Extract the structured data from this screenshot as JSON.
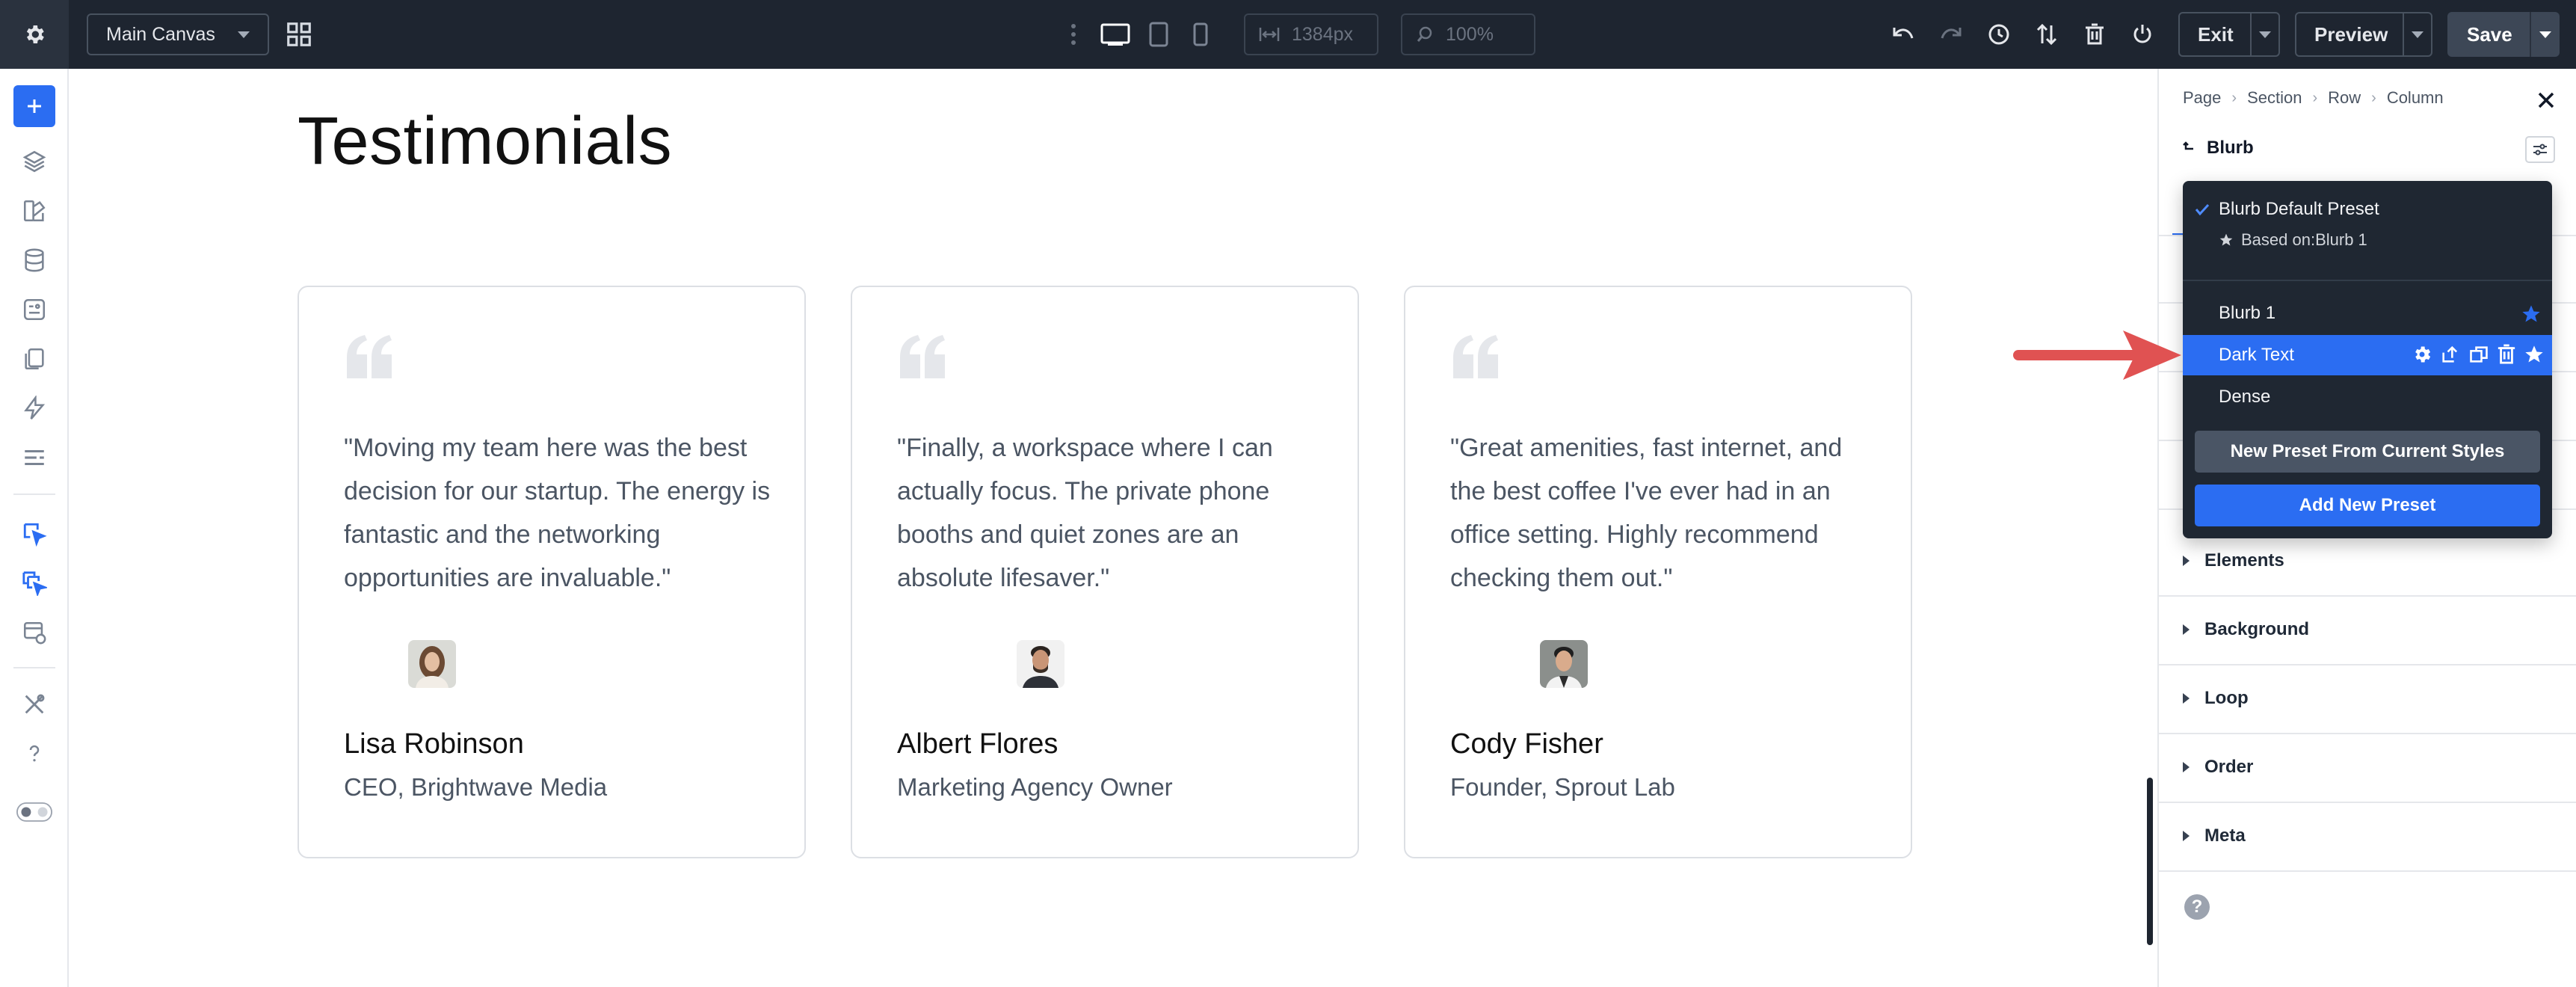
{
  "toolbar": {
    "canvas_select": "Main Canvas",
    "width_value": "1384px",
    "zoom_value": "100%",
    "exit_label": "Exit",
    "preview_label": "Preview",
    "save_label": "Save"
  },
  "canvas": {
    "title": "Testimonials",
    "cards": [
      {
        "quote": "\"Moving my team here was the best decision for our startup. The energy is fantastic and the networking opportunities are invaluable.\"",
        "name": "Lisa Robinson",
        "role": "CEO, Brightwave Media"
      },
      {
        "quote": "\"Finally, a workspace where I can actually focus. The private phone booths and quiet zones are an absolute lifesaver.\"",
        "name": "Albert Flores",
        "role": "Marketing Agency Owner"
      },
      {
        "quote": "\"Great amenities, fast internet, and the best coffee I've ever had in an office setting. Highly recommend checking them out.\"",
        "name": "Cody Fisher",
        "role": "Founder, Sprout Lab"
      }
    ]
  },
  "panel": {
    "breadcrumbs": [
      "Page",
      "Section",
      "Row",
      "Column"
    ],
    "module_name": "Blurb",
    "sections": [
      "Elements",
      "Background",
      "Loop",
      "Order",
      "Meta"
    ]
  },
  "preset_menu": {
    "default_preset": "Blurb Default Preset",
    "based_on": "Based on:Blurb 1",
    "presets": [
      "Blurb 1",
      "Dark Text",
      "Dense"
    ],
    "active_preset": "Dark Text",
    "new_from_current": "New Preset From Current Styles",
    "add_new": "Add New Preset"
  },
  "colors": {
    "toolbar_bg": "#1e2530",
    "accent": "#2b6df2",
    "annotation_arrow": "#e05252"
  }
}
